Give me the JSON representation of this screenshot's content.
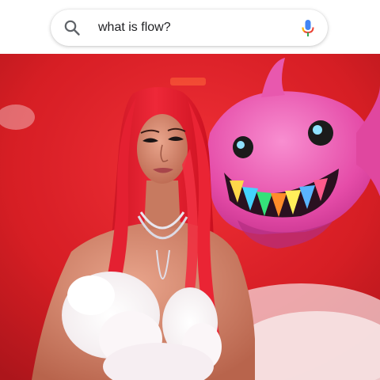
{
  "search": {
    "query": "what is flow?"
  },
  "icons": {
    "search": "search-icon",
    "mic": "mic-icon"
  },
  "colors": {
    "mic_blue": "#4285f4",
    "mic_red": "#ea4335",
    "mic_yellow": "#fbbc05",
    "mic_green": "#34a853",
    "room_red": "#d8131a",
    "hair_red": "#e61d2c",
    "shark_pink": "#ec4fa8"
  }
}
